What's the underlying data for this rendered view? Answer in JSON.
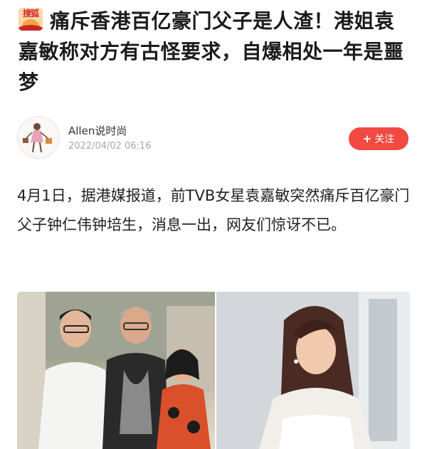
{
  "logo": {
    "text": "搜狐",
    "icon": "sohu-logo-icon"
  },
  "article": {
    "title": "痛斥香港百亿豪门父子是人渣！港姐袁嘉敏称对方有古怪要求，自爆相处一年是噩梦",
    "body": "4月1日，据港媒报道，前TVB女星袁嘉敏突然痛斥百亿豪门父子钟仁伟钟培生，消息一出，网友们惊讶不已。"
  },
  "author": {
    "name": "Allen说时尚",
    "date": "2022/04/02 06:16",
    "avatar_icon": "fashion-woman-avatar-icon"
  },
  "follow": {
    "plus": "+",
    "label": "关注"
  },
  "colors": {
    "accent": "#f04a43",
    "meta": "#a8a8a8",
    "text": "#222222"
  }
}
